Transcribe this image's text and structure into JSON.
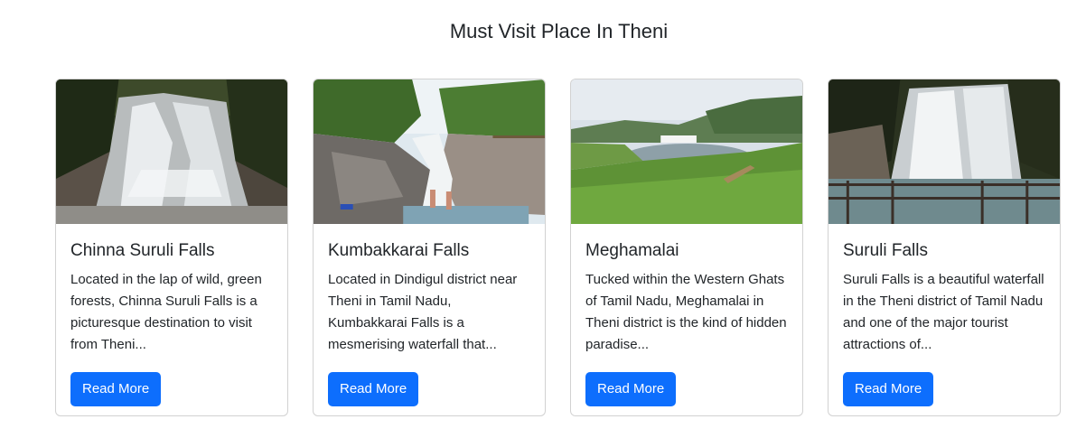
{
  "section": {
    "title": "Must Visit Place In Theni"
  },
  "cards": [
    {
      "title": "Chinna Suruli Falls",
      "text": "Located in the lap of wild, green forests, Chinna Suruli Falls is a picturesque destination to visit from Theni...",
      "button": "Read More",
      "image": "waterfall-forest-photo"
    },
    {
      "title": "Kumbakkarai Falls",
      "text": "Located in Dindigul district near Theni in Tamil Nadu, Kumbakkarai Falls is a mesmerising waterfall that...",
      "button": "Read More",
      "image": "waterfall-rocks-photo"
    },
    {
      "title": "Meghamalai",
      "text": "Tucked within the Western Ghats of Tamil Nadu, Meghamalai in Theni district is the kind of hidden paradise...",
      "button": "Read More",
      "image": "lake-tea-estate-photo"
    },
    {
      "title": "Suruli Falls",
      "text": "Suruli Falls is a beautiful waterfall in the Theni district of Tamil Nadu and one of the major tourist attractions of...",
      "button": "Read More",
      "image": "waterfall-railing-photo"
    }
  ],
  "colors": {
    "primary": "#0d6efd",
    "text": "#212529"
  }
}
